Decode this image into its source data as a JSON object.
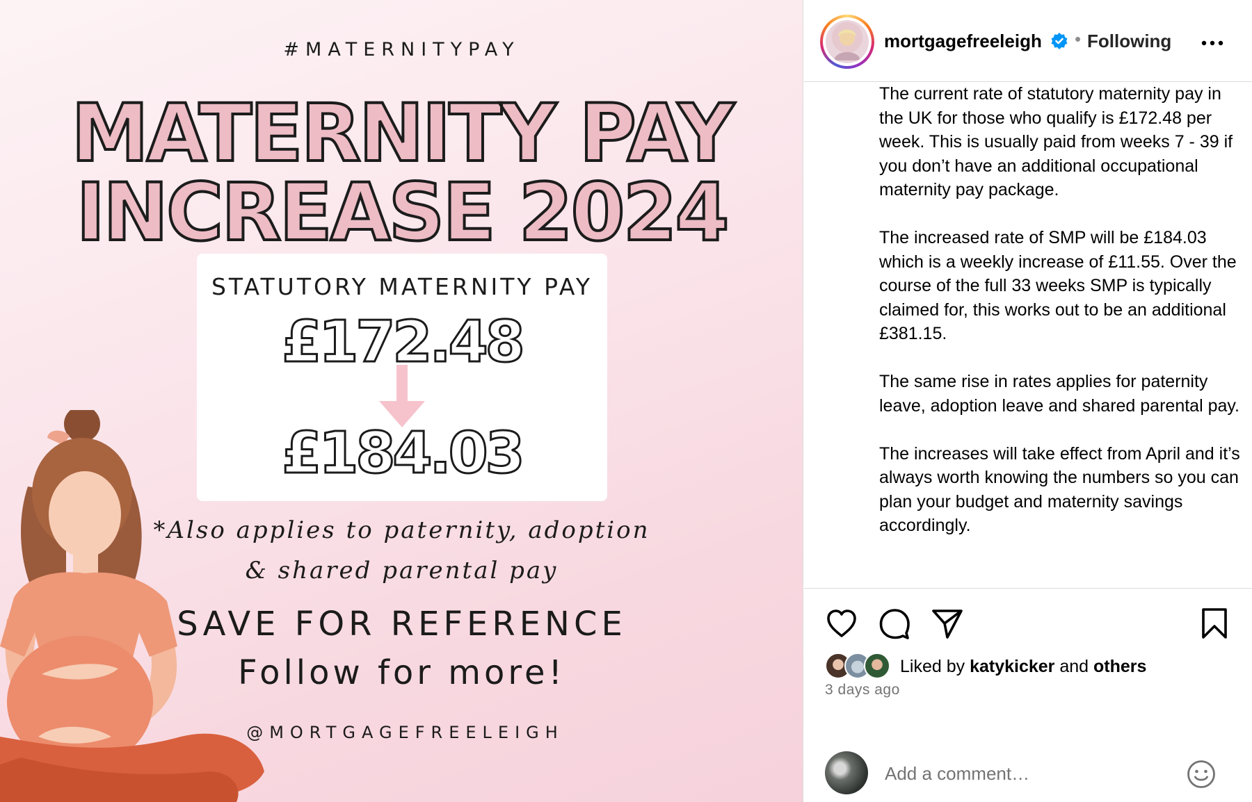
{
  "image": {
    "hashtag": "#MATERNITYPAY",
    "headline_line1": "MATERNITY PAY",
    "headline_line2": "INCREASE 2024",
    "card_title": "STATUTORY MATERNITY PAY",
    "old_amount": "£172.48",
    "new_amount": "£184.03",
    "also_line1": "*Also applies to paternity, adoption",
    "also_line2": "& shared parental pay",
    "save_text": "SAVE FOR REFERENCE",
    "follow_text": "Follow for more!",
    "handle": "@MORTGAGEFREELEIGH"
  },
  "header": {
    "username": "mortgagefreeleigh",
    "separator": "•",
    "follow_status": "Following"
  },
  "caption": {
    "paragraphs": [
      "The current rate of statutory maternity pay in the UK for those who qualify is £172.48 per week. This is usually paid from weeks 7 - 39 if you don’t have an additional occupational maternity pay package.",
      "The increased rate of SMP will be £184.03 which is a weekly increase of £11.55. Over the course of the full 33 weeks SMP is typically claimed for, this works out to be an additional £381.15.",
      "The same rise in rates applies for paternity leave, adoption leave and shared parental pay.",
      "The increases will take effect from April and it’s always worth knowing the numbers so you can plan your budget and maternity savings accordingly."
    ]
  },
  "likes": {
    "prefix": "Liked by",
    "user": "katykicker",
    "joiner": "and",
    "others": "others"
  },
  "timestamp": "3 days ago",
  "comment": {
    "placeholder": "Add a comment…"
  },
  "icons": {
    "verified": "verified-badge-icon",
    "more": "more-options-icon",
    "like": "heart-icon",
    "comment": "comment-bubble-icon",
    "share": "paper-plane-icon",
    "save": "bookmark-icon",
    "emoji": "smiley-icon"
  },
  "colors": {
    "verified_blue": "#0095f6",
    "headline_pink": "#edbcc4",
    "arrow_pink": "#f6c3cc",
    "muted_text": "#737373"
  }
}
